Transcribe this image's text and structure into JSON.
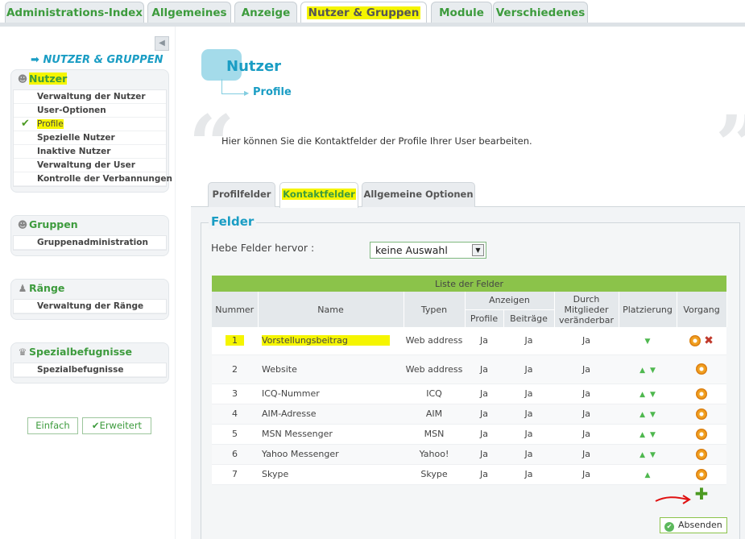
{
  "top_tabs": [
    {
      "label": "Administrations-Index"
    },
    {
      "label": "Allgemeines"
    },
    {
      "label": "Anzeige"
    },
    {
      "label": "Nutzer & Gruppen"
    },
    {
      "label": "Module"
    },
    {
      "label": "Verschiedenes"
    }
  ],
  "sidebar": {
    "collapse_icon": "triangle-left-icon",
    "heading": "NUTZER & GRUPPEN",
    "groups": [
      {
        "title": "Nutzer",
        "icon": "user-icon",
        "items": [
          "Verwaltung der Nutzer",
          "User-Optionen",
          "Profile",
          "Spezielle Nutzer",
          "Inaktive Nutzer",
          "Verwaltung der User",
          "Kontrolle der Verbannungen"
        ]
      },
      {
        "title": "Gruppen",
        "icon": "users-icon",
        "items": [
          "Gruppenadministration"
        ]
      },
      {
        "title": "Ränge",
        "icon": "rank-icon",
        "items": [
          "Verwaltung der Ränge"
        ]
      },
      {
        "title": "Spezialbefugnisse",
        "icon": "special-rights-icon",
        "items": [
          "Spezialbefugnisse"
        ]
      }
    ],
    "mode_simple": "Einfach",
    "mode_advanced": "Erweitert"
  },
  "page": {
    "title": "Nutzer",
    "subtitle": "Profile",
    "description": "Hier können Sie die Kontaktfelder der Profile Ihrer User bearbeiten.",
    "quote_open": "“",
    "quote_close": "”"
  },
  "content_tabs": [
    {
      "label": "Profilfelder"
    },
    {
      "label": "Kontaktfelder"
    },
    {
      "label": "Allgemeine Optionen"
    }
  ],
  "fields": {
    "legend": "Felder",
    "highlight_label": "Hebe Felder hervor :",
    "highlight_value": "keine Auswahl",
    "table_caption": "Liste der Felder",
    "columns": {
      "nummer": "Nummer",
      "name": "Name",
      "typen": "Typen",
      "anzeigen": "Anzeigen",
      "profile": "Profile",
      "beitraege": "Beiträge",
      "durch": "Durch Mitglieder veränderbar",
      "platzierung": "Platzierung",
      "vorgang": "Vorgang"
    },
    "rows": [
      {
        "num": "1",
        "name": "Vorstellungsbeitrag",
        "type": "Web address",
        "profile": "Ja",
        "posts": "Ja",
        "editable": "Ja"
      },
      {
        "num": "2",
        "name": "Website",
        "type": "Web address",
        "profile": "Ja",
        "posts": "Ja",
        "editable": "Ja"
      },
      {
        "num": "3",
        "name": "ICQ-Nummer",
        "type": "ICQ",
        "profile": "Ja",
        "posts": "Ja",
        "editable": "Ja"
      },
      {
        "num": "4",
        "name": "AIM-Adresse",
        "type": "AIM",
        "profile": "Ja",
        "posts": "Ja",
        "editable": "Ja"
      },
      {
        "num": "5",
        "name": "MSN Messenger",
        "type": "MSN",
        "profile": "Ja",
        "posts": "Ja",
        "editable": "Ja"
      },
      {
        "num": "6",
        "name": "Yahoo Messenger",
        "type": "Yahoo!",
        "profile": "Ja",
        "posts": "Ja",
        "editable": "Ja"
      },
      {
        "num": "7",
        "name": "Skype",
        "type": "Skype",
        "profile": "Ja",
        "posts": "Ja",
        "editable": "Ja"
      }
    ],
    "submit_label": "Absenden"
  },
  "colors": {
    "green": "#3d9b3d",
    "blue": "#1a9dc4",
    "highlight": "#f5f500",
    "table_header": "#8bc34a"
  }
}
